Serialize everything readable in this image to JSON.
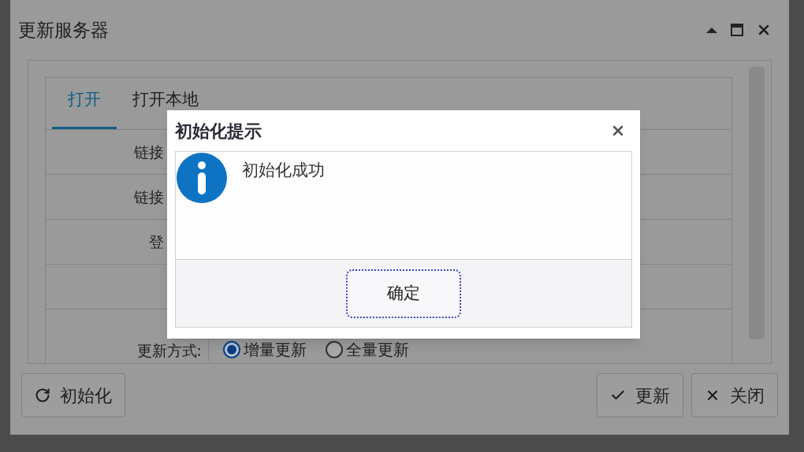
{
  "window": {
    "title": "更新服务器"
  },
  "tabs": [
    {
      "label": "打开",
      "selected": true
    },
    {
      "label": "打开本地",
      "selected": false
    }
  ],
  "form": {
    "rows": [
      {
        "label": "链接"
      },
      {
        "label": "链接"
      },
      {
        "label": "登"
      }
    ],
    "update_mode": {
      "label": "更新方式:",
      "options": [
        {
          "label": "增量更新",
          "selected": true
        },
        {
          "label": "全量更新",
          "selected": false
        }
      ]
    }
  },
  "left_buttons": [
    {
      "label": "初始化",
      "kind": "refresh"
    }
  ],
  "right_buttons": [
    {
      "label": "更新",
      "kind": "check"
    },
    {
      "label": "关闭",
      "kind": "close"
    }
  ],
  "dialog": {
    "title": "初始化提示",
    "message": "初始化成功",
    "button": "确定"
  }
}
